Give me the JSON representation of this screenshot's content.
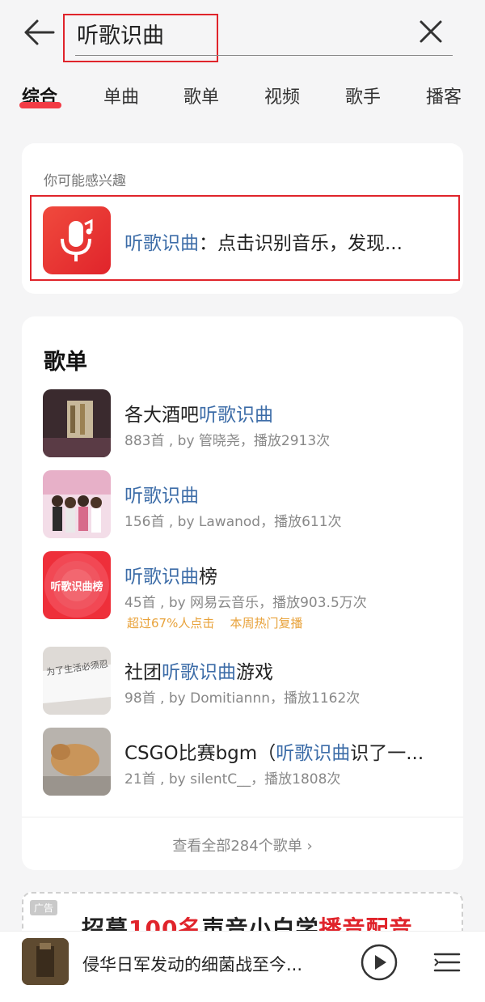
{
  "search": {
    "query": "听歌识曲"
  },
  "tabs": [
    "综合",
    "单曲",
    "歌单",
    "视频",
    "歌手",
    "播客"
  ],
  "interest": {
    "subtitle": "你可能感兴趣",
    "title_highlight": "听歌识曲",
    "title_rest": "：点击识别音乐，发现..."
  },
  "playlists": {
    "section_title": "歌单",
    "items": [
      {
        "title_before": "各大酒吧",
        "title_highlight": "听歌识曲",
        "title_after": "",
        "meta": "883首 , by 管晓尧，播放2913次",
        "tags": []
      },
      {
        "title_before": "",
        "title_highlight": "听歌识曲",
        "title_after": "",
        "meta": "156首 , by Lawanod，播放611次",
        "tags": []
      },
      {
        "title_before": "",
        "title_highlight": "听歌识曲",
        "title_after": "榜",
        "meta": "45首 , by 网易云音乐，播放903.5万次",
        "tags": [
          "超过67%人点击",
          "本周热门复播"
        ],
        "cover_text": "听歌识曲榜"
      },
      {
        "title_before": "社团",
        "title_highlight": "听歌识曲",
        "title_after": "游戏",
        "meta": "98首 , by Domitiannn，播放1162次",
        "tags": [],
        "cover_text": "为了生活必须忍"
      },
      {
        "title_before": "CSGO比赛bgm（",
        "title_highlight": "听歌识曲",
        "title_after": "识了一...",
        "meta": "21首 , by silentC__，播放1808次",
        "tags": []
      }
    ],
    "more_label": "查看全部284个歌单",
    "more_chevron": "›"
  },
  "ad": {
    "badge": "广告",
    "text_1": "招募",
    "text_red_1": "100名",
    "text_2": "声音小白学",
    "text_red_2": "播音配音"
  },
  "player": {
    "title": "侵华日军发动的细菌战至今..."
  },
  "colors": {
    "accent_red": "#e0242b",
    "highlight_blue": "#3d6da8",
    "tag_orange": "#e8a23a"
  }
}
